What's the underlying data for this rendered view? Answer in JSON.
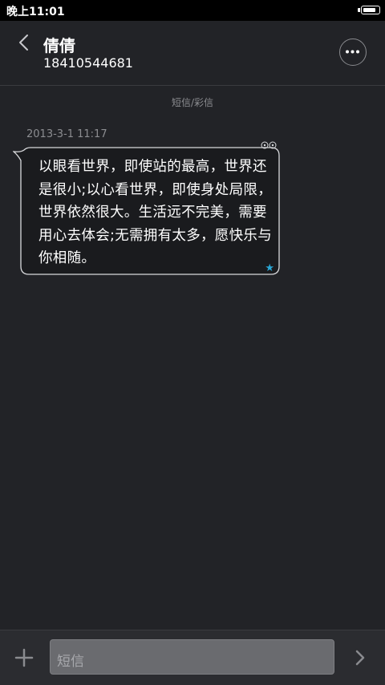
{
  "status_bar": {
    "time": "晚上11:01",
    "battery_icon": "battery-icon",
    "battery_level": 0.9
  },
  "header": {
    "back_icon": "chevron-left-icon",
    "contact_name": "倩倩",
    "contact_number": "18410544681",
    "more_icon": "more-dots-icon"
  },
  "conversation": {
    "section_label": "短信/彩信",
    "messages": [
      {
        "timestamp": "2013-3-1 11:17",
        "text": "以眼看世界，即使站的最高，世界还是很小;以心看世界，即使身处局限，世界依然很大。生活远不完美，需要用心去体会;无需拥有太多，愿快乐与你相随。",
        "star_icon": "star-icon",
        "star_color": "#2aa7d6"
      }
    ]
  },
  "composer": {
    "add_icon": "plus-icon",
    "placeholder": "短信",
    "send_icon": "chevron-right-icon"
  },
  "colors": {
    "background": "#222327",
    "accent": "#2aa7d6"
  }
}
